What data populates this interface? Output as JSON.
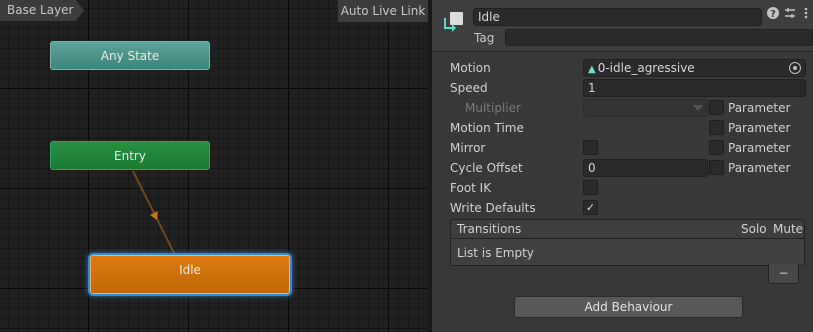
{
  "graph": {
    "breadcrumb": "Base Layer",
    "live_link_label": "Auto Live Link",
    "nodes": {
      "any_state": "Any State",
      "entry": "Entry",
      "idle": "Idle"
    }
  },
  "inspector": {
    "state_name": "Idle",
    "tag_label": "Tag",
    "tag_value": "",
    "header_icons": [
      "help-icon",
      "preset-icon",
      "menu-icon"
    ],
    "fields": {
      "motion_label": "Motion",
      "motion_value": "0-idle_agressive",
      "speed_label": "Speed",
      "speed_value": "1",
      "multiplier_label": "Multiplier",
      "motion_time_label": "Motion Time",
      "mirror_label": "Mirror",
      "cycle_offset_label": "Cycle Offset",
      "cycle_offset_value": "0",
      "foot_ik_label": "Foot IK",
      "write_defaults_label": "Write Defaults",
      "parameter_label": "Parameter"
    },
    "checkboxes": {
      "mirror": false,
      "foot_ik": false,
      "write_defaults": true,
      "multiplier_parameter": false,
      "motion_time_parameter": false,
      "mirror_parameter": false,
      "cycle_offset_parameter": false
    },
    "transitions": {
      "title": "Transitions",
      "solo_label": "Solo",
      "mute_label": "Mute",
      "empty_text": "List is Empty",
      "remove_label": "−"
    },
    "add_behaviour_label": "Add Behaviour"
  },
  "colors": {
    "any_state": "#4f978d",
    "entry": "#22873a",
    "idle": "#d1710e",
    "selection_outline": "#2b8fd8",
    "transition_arrow": "#b0700e"
  }
}
